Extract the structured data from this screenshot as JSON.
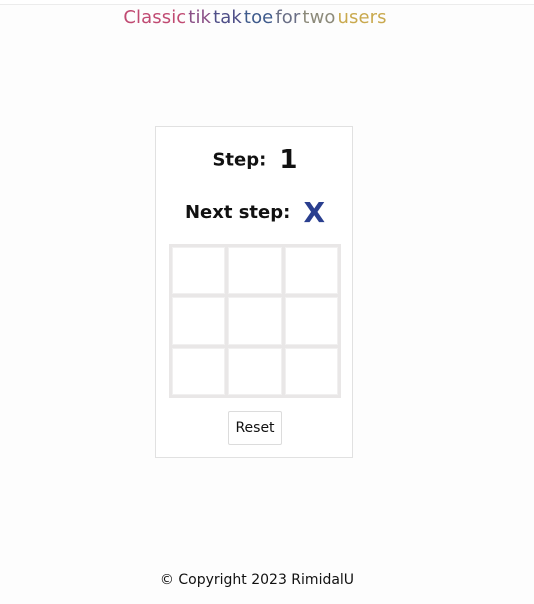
{
  "title": {
    "words": [
      {
        "text": "Classic",
        "color": "#c04a72"
      },
      {
        "text": "tik",
        "color": "#8a4f86"
      },
      {
        "text": "tak",
        "color": "#4f4f88"
      },
      {
        "text": "toe",
        "color": "#3f5b8c"
      },
      {
        "text": "for",
        "color": "#6a6f86"
      },
      {
        "text": "two",
        "color": "#8c8a7a"
      },
      {
        "text": "users",
        "color": "#c9a94e"
      }
    ]
  },
  "game": {
    "step_label": "Step:",
    "step_value": "1",
    "next_label": "Next step:",
    "next_value": "X",
    "next_color": "#2a3f8f",
    "board": [
      "",
      "",
      "",
      "",
      "",
      "",
      "",
      "",
      ""
    ],
    "reset_label": "Reset"
  },
  "footer": {
    "text": "© Copyright 2023 RimidalU"
  }
}
